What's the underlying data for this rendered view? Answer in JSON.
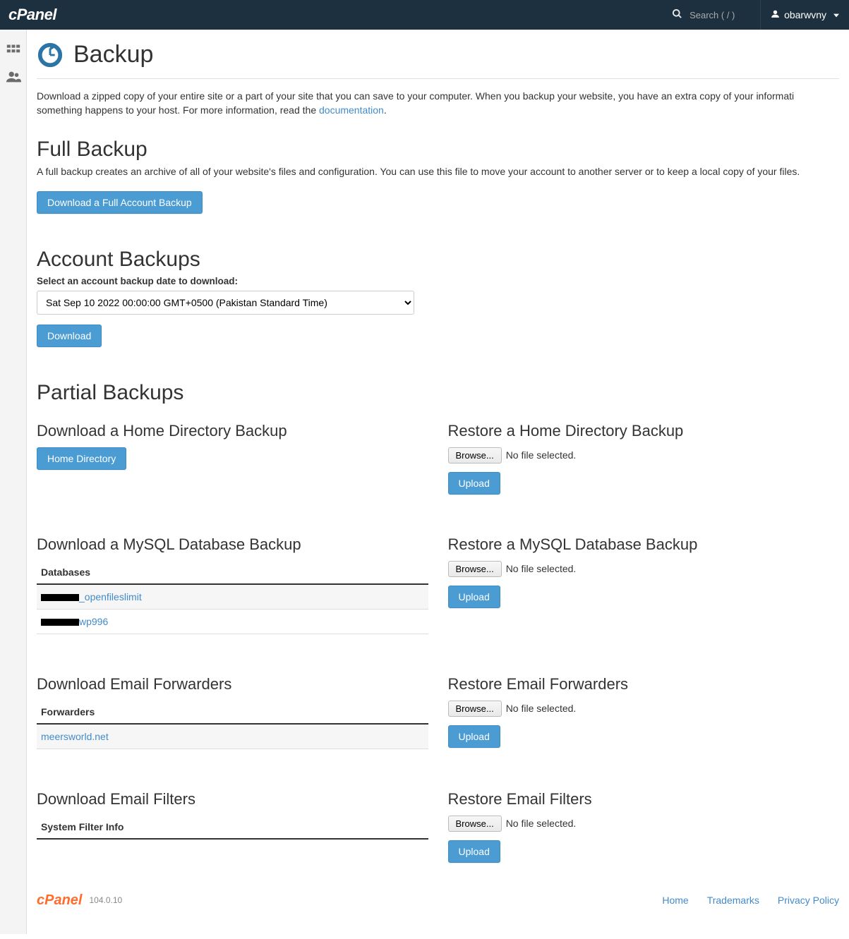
{
  "header": {
    "logo_text": "cPanel",
    "search_placeholder": "Search ( / )",
    "username": "obarwvny"
  },
  "page": {
    "title": "Backup",
    "intro_part1": "Download a zipped copy of your entire site or a part of your site that you can save to your computer. When you backup your website, you have an extra copy of your informati something happens to your host. For more information, read the ",
    "doc_link_text": "documentation",
    "intro_part2": "."
  },
  "full_backup": {
    "heading": "Full Backup",
    "desc": "A full backup creates an archive of all of your website's files and configuration. You can use this file to move your account to another server or to keep a local copy of your files.",
    "button": "Download a Full Account Backup"
  },
  "account_backups": {
    "heading": "Account Backups",
    "label": "Select an account backup date to download:",
    "selected_option": "Sat Sep 10 2022 00:00:00 GMT+0500 (Pakistan Standard Time)",
    "download_button": "Download"
  },
  "partial": {
    "heading": "Partial Backups",
    "home": {
      "download_heading": "Download a Home Directory Backup",
      "download_button": "Home Directory",
      "restore_heading": "Restore a Home Directory Backup",
      "browse": "Browse...",
      "nofile": "No file selected.",
      "upload": "Upload"
    },
    "mysql": {
      "download_heading": "Download a MySQL Database Backup",
      "table_header": "Databases",
      "db1_suffix": "_openfileslimit",
      "db2_suffix": "wp996",
      "restore_heading": "Restore a MySQL Database Backup",
      "browse": "Browse...",
      "nofile": "No file selected.",
      "upload": "Upload"
    },
    "forwarders": {
      "download_heading": "Download Email Forwarders",
      "table_header": "Forwarders",
      "item1": "meersworld.net",
      "restore_heading": "Restore Email Forwarders",
      "browse": "Browse...",
      "nofile": "No file selected.",
      "upload": "Upload"
    },
    "filters": {
      "download_heading": "Download Email Filters",
      "table_header": "System Filter Info",
      "restore_heading": "Restore Email Filters",
      "browse": "Browse...",
      "nofile": "No file selected.",
      "upload": "Upload"
    }
  },
  "footer": {
    "logo": "cPanel",
    "version": "104.0.10",
    "links": {
      "home": "Home",
      "trademarks": "Trademarks",
      "privacy": "Privacy Policy"
    }
  },
  "colors": {
    "accent": "#4b9cd3",
    "topbar": "#1d3040",
    "brand_orange": "#ff6c2c"
  }
}
